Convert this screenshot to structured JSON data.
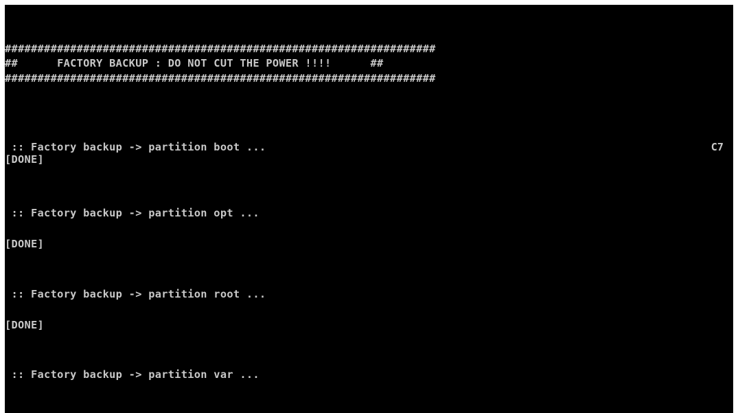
{
  "colors": {
    "frame": "#ffffff",
    "background": "#000000",
    "text": "#c8c8c8"
  },
  "banner": {
    "border_top": "##################################################################",
    "title_line": "##      FACTORY BACKUP : DO NOT CUT THE POWER !!!!      ##",
    "border_bottom": "##################################################################"
  },
  "log": [
    {
      "text": " :: Factory backup -> partition boot ...",
      "status": "[DONE]",
      "right_code": "C7"
    },
    {
      "text": " :: Factory backup -> partition opt ...",
      "status": "[DONE]"
    },
    {
      "text": " :: Factory backup -> partition root ...",
      "status": "[DONE]"
    },
    {
      "text": " :: Factory backup -> partition var ..."
    }
  ]
}
